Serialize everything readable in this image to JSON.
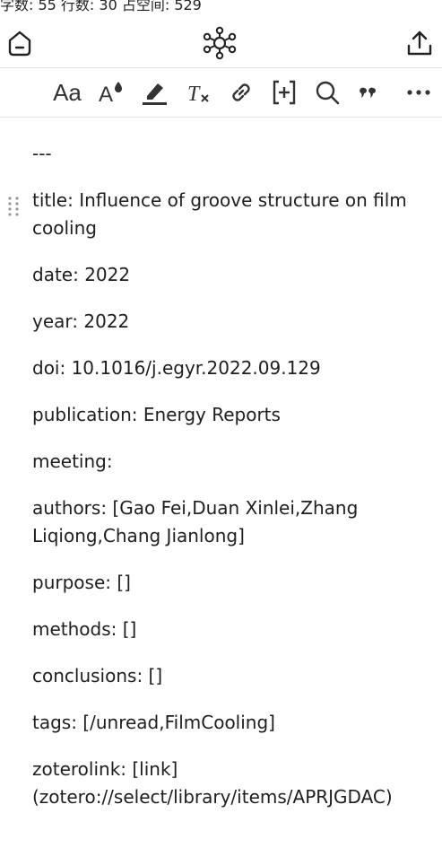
{
  "status_bar": {
    "text": "字数: 55 行数: 30 占空间: 529"
  },
  "top_bar": {
    "left_icon": "home-icon",
    "center_icon": "graph-view-icon",
    "right_icon": "share-icon"
  },
  "toolbar": {
    "icons": [
      "text-size-icon",
      "text-color-icon",
      "highlight-icon",
      "clear-format-icon",
      "link-icon",
      "insert-block-icon",
      "search-icon",
      "quote-icon",
      "more-icon"
    ],
    "text_size_label": "Aa",
    "text_color_label": "A",
    "clear_format_label": "T"
  },
  "document": {
    "lines": [
      "---",
      "title: Influence of groove structure on film cooling",
      "date: 2022",
      "year: 2022",
      "doi: 10.1016/j.egyr.2022.09.129",
      "publication: Energy Reports",
      "meeting:",
      "authors: [Gao Fei,Duan Xinlei,Zhang Liqiong,Chang Jianlong]",
      "purpose: []",
      "methods: []",
      "conclusions: []",
      "tags: [/unread,FilmCooling]",
      "zoterolink: [link](zotero://select/library/items/APRJGDAC)"
    ]
  }
}
